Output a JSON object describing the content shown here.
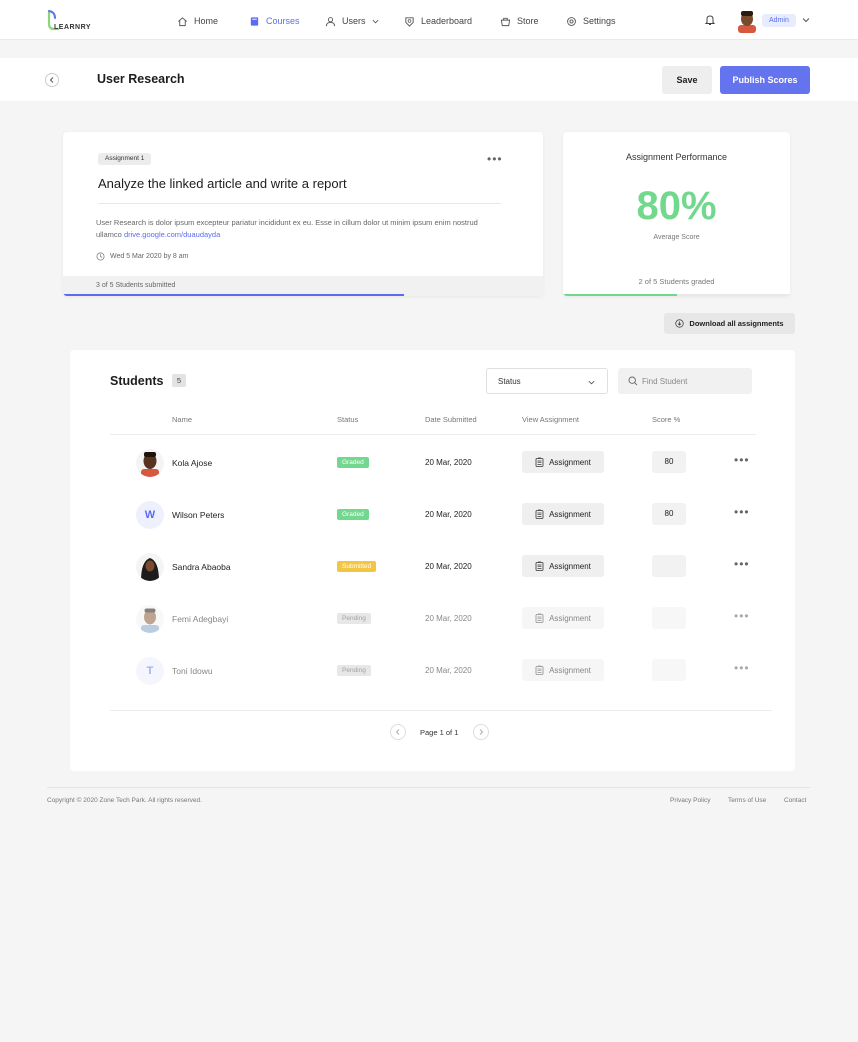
{
  "app": {
    "logo_text": "LEARNRY"
  },
  "nav": {
    "items": [
      {
        "label": "Home",
        "icon": "home-icon"
      },
      {
        "label": "Courses",
        "icon": "book-icon"
      },
      {
        "label": "Users",
        "icon": "user-icon"
      },
      {
        "label": "Leaderboard",
        "icon": "badge-icon"
      },
      {
        "label": "Store",
        "icon": "basket-icon"
      },
      {
        "label": "Settings",
        "icon": "gear-icon"
      }
    ],
    "active": "Courses",
    "admin_label": "Admin"
  },
  "header": {
    "title": "User Research",
    "save_label": "Save",
    "publish_label": "Publish Scores"
  },
  "assignment": {
    "tag": "Assignment 1",
    "title": "Analyze the linked article and write a report",
    "description": "User Research is dolor ipsum excepteur pariatur incididunt ex eu. Esse in cillum dolor ut minim ipsum enim nostrud ullamco ",
    "link": "drive.google.com/duaudayda",
    "due": "Wed 5 Mar 2020 by 8 am",
    "submitted_text": "3 of 5 Students submitted",
    "submitted_fraction": 0.71
  },
  "performance": {
    "title": "Assignment Performance",
    "value": "80%",
    "subtitle": "Average Score",
    "graded_text": "2 of 5 Students graded",
    "graded_fraction": 0.5
  },
  "download_label": "Download all assignments",
  "students": {
    "title": "Students",
    "count": "5",
    "status_filter": "Status",
    "search_placeholder": "Find Student",
    "columns": {
      "name": "Name",
      "status": "Status",
      "date": "Date Submitted",
      "view": "View Assignment",
      "score": "Score %"
    },
    "rows": [
      {
        "name": "Kola Ajose",
        "status": "Graded",
        "date": "20 Mar, 2020",
        "assignment": "Assignment",
        "score": "80",
        "avatar": "photo-dark"
      },
      {
        "name": "Wilson Peters",
        "status": "Graded",
        "date": "20 Mar, 2020",
        "assignment": "Assignment",
        "score": "80",
        "avatar_letter": "W"
      },
      {
        "name": "Sandra Abaoba",
        "status": "Submitted",
        "date": "20 Mar, 2020",
        "assignment": "Assignment",
        "score": "",
        "avatar": "photo-hijab"
      },
      {
        "name": "Femi Adegbayi",
        "status": "Pending",
        "date": "20 Mar, 2020",
        "assignment": "Assignment",
        "score": "",
        "avatar": "photo-light"
      },
      {
        "name": "Toni Idowu",
        "status": "Pending",
        "date": "20 Mar, 2020",
        "assignment": "Assignment",
        "score": "",
        "avatar_letter": "T"
      }
    ],
    "pagination": "Page 1 of 1"
  },
  "colors": {
    "accent": "#5b6cf0",
    "graded": "#72d88e",
    "submitted": "#f3c545",
    "pending": "#d4d4d4"
  },
  "footer": {
    "copyright": "Copyright © 2020 Zone Tech Park. All rights reserved.",
    "links": [
      "Privacy Policy",
      "Terms of Use",
      "Contact"
    ]
  }
}
